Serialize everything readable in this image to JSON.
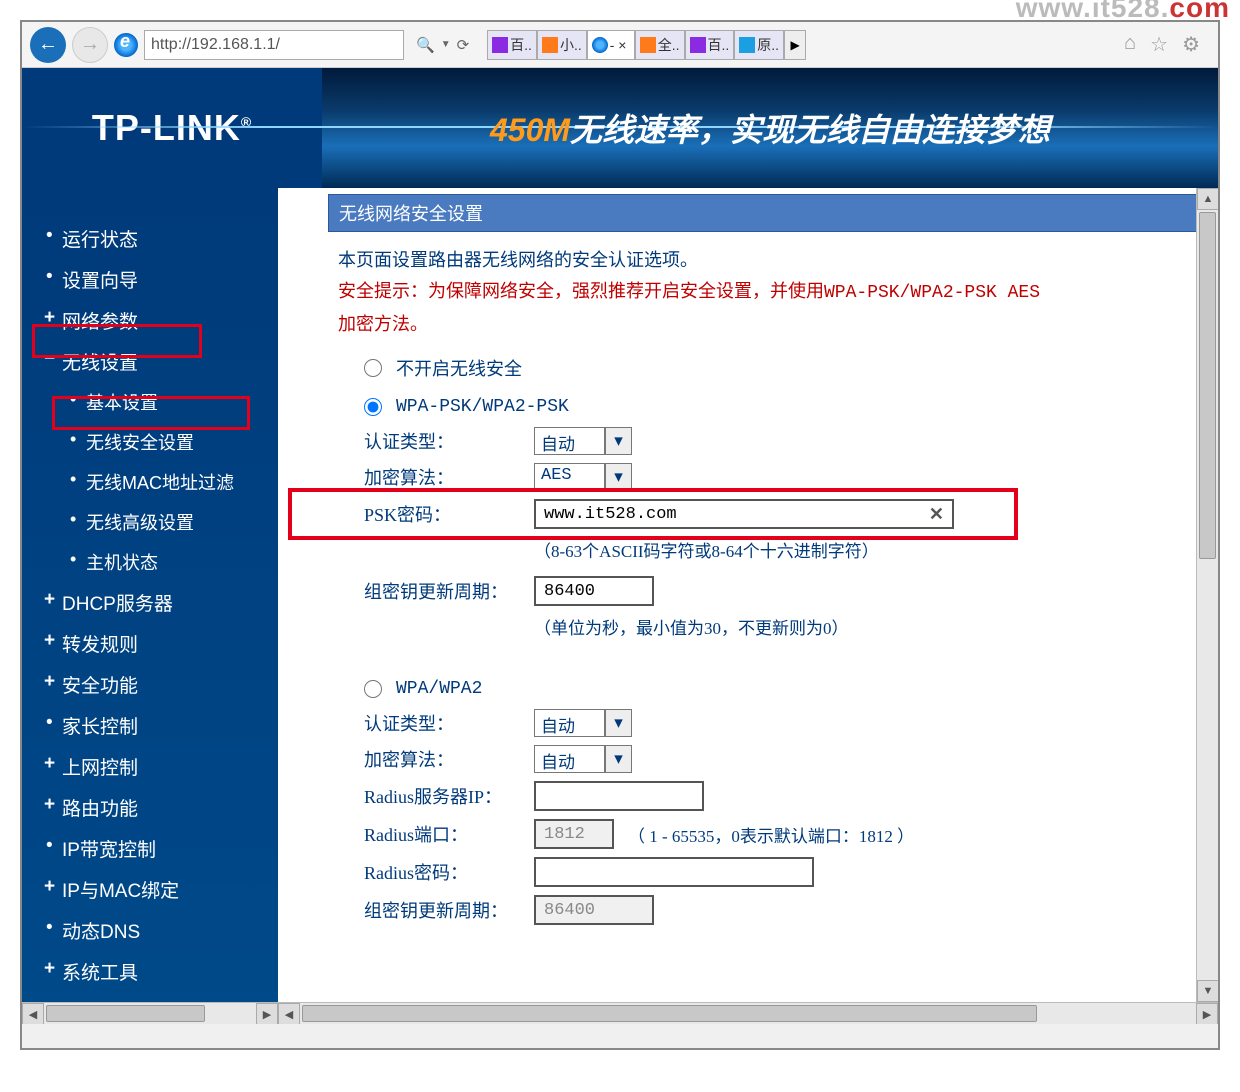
{
  "watermark": {
    "prefix": "www.it528.",
    "suffix": "com"
  },
  "browser": {
    "url": "http://192.168.1.1/",
    "search_icon": "🔍",
    "refresh_icon": "⟳",
    "dropdown_icon": "▼",
    "tabs": [
      {
        "label": "百..",
        "icon": "purple"
      },
      {
        "label": "小..",
        "icon": "orange"
      },
      {
        "label": "- ×",
        "icon": "ie"
      },
      {
        "label": "全..",
        "icon": "orange"
      },
      {
        "label": "百..",
        "icon": "purple"
      },
      {
        "label": "原..",
        "icon": "blue"
      }
    ],
    "more": "▶",
    "home_icon": "⌂",
    "star_icon": "☆",
    "gear_icon": "⚙"
  },
  "banner": {
    "logo": "TP-LINK",
    "highlight": "450M",
    "slogan": "无线速率，实现无线自由连接梦想"
  },
  "sidebar": {
    "items": [
      {
        "label": "运行状态",
        "type": "dot"
      },
      {
        "label": "设置向导",
        "type": "dot"
      },
      {
        "label": "网络参数",
        "type": "plus"
      },
      {
        "label": "无线设置",
        "type": "minus"
      },
      {
        "label": "基本设置",
        "type": "sub"
      },
      {
        "label": "无线安全设置",
        "type": "sub"
      },
      {
        "label": "无线MAC地址过滤",
        "type": "sub"
      },
      {
        "label": "无线高级设置",
        "type": "sub"
      },
      {
        "label": "主机状态",
        "type": "sub"
      },
      {
        "label": "DHCP服务器",
        "type": "plus"
      },
      {
        "label": "转发规则",
        "type": "plus"
      },
      {
        "label": "安全功能",
        "type": "plus"
      },
      {
        "label": "家长控制",
        "type": "dot"
      },
      {
        "label": "上网控制",
        "type": "plus"
      },
      {
        "label": "路由功能",
        "type": "plus"
      },
      {
        "label": "IP带宽控制",
        "type": "dot"
      },
      {
        "label": "IP与MAC绑定",
        "type": "plus"
      },
      {
        "label": "动态DNS",
        "type": "dot"
      },
      {
        "label": "系统工具",
        "type": "plus"
      }
    ]
  },
  "panel": {
    "title": "无线网络安全设置",
    "intro": "本页面设置路由器无线网络的安全认证选项。",
    "warning_prefix": "安全提示：为保障网络安全，强烈推荐开启安全设置，并使用",
    "warning_mono": "WPA-PSK/WPA2-PSK AES",
    "warning_suffix": "加密方法。",
    "opt_none": "不开启无线安全",
    "opt_wpapsk": "WPA-PSK/WPA2-PSK",
    "opt_wpa": "WPA/WPA2",
    "auth_label": "认证类型：",
    "auth_value": "自动",
    "enc_label": "加密算法：",
    "enc_value_aes": "AES",
    "enc_value_auto": "自动",
    "psk_label": "PSK密码：",
    "psk_value": "www.it528.com",
    "psk_hint": "（8-63个ASCII码字符或8-64个十六进制字符）",
    "rekey_label": "组密钥更新周期：",
    "rekey_value": "86400",
    "rekey_value2": "86400",
    "rekey_hint": "（单位为秒，最小值为30，不更新则为0）",
    "radius_ip_label": "Radius服务器IP：",
    "radius_port_label": "Radius端口：",
    "radius_port_value": "1812",
    "radius_port_hint": "（ 1 - 65535，0表示默认端口：1812 ）",
    "radius_pwd_label": "Radius密码："
  }
}
